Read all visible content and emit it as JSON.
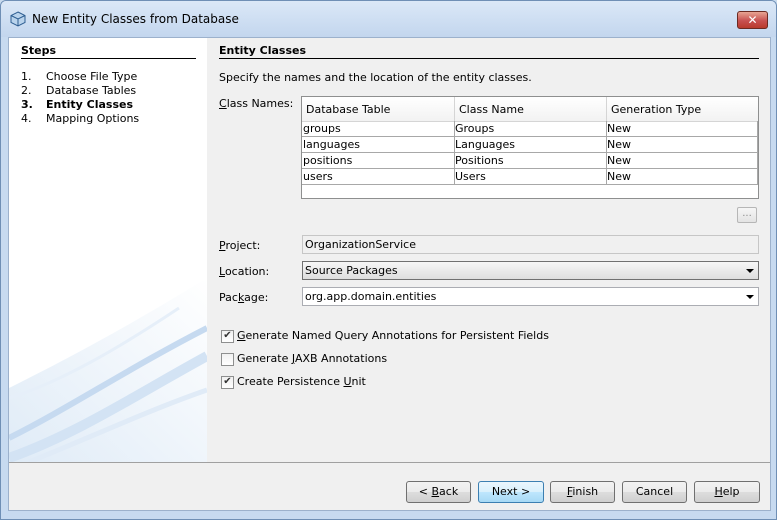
{
  "window": {
    "title": "New Entity Classes from Database",
    "close_label": "✕"
  },
  "steps": {
    "title": "Steps",
    "items": [
      {
        "num": "1.",
        "label": "Choose File Type"
      },
      {
        "num": "2.",
        "label": "Database Tables"
      },
      {
        "num": "3.",
        "label": "Entity Classes"
      },
      {
        "num": "4.",
        "label": "Mapping Options"
      }
    ],
    "current_index": 2
  },
  "panel": {
    "title": "Entity Classes",
    "description": "Specify the names and the location of the entity classes.",
    "class_names_label_pre": "",
    "class_names_label_mn": "C",
    "class_names_label_post": "lass Names:",
    "table": {
      "headers": [
        "Database Table",
        "Class Name",
        "Generation Type"
      ],
      "rows": [
        [
          "groups",
          "Groups",
          "New"
        ],
        [
          "languages",
          "Languages",
          "New"
        ],
        [
          "positions",
          "Positions",
          "New"
        ],
        [
          "users",
          "Users",
          "New"
        ]
      ]
    },
    "ellipsis_label": "...",
    "project_label_pre": "",
    "project_label_mn": "P",
    "project_label_post": "roject:",
    "project_value": "OrganizationService",
    "location_label_pre": "",
    "location_label_mn": "L",
    "location_label_post": "ocation:",
    "location_value": "Source Packages",
    "package_label_pre": "Pac",
    "package_label_mn": "k",
    "package_label_post": "age:",
    "package_value": "org.app.domain.entities",
    "checkboxes": [
      {
        "pre": "",
        "mn": "G",
        "post": "enerate Named Query Annotations for Persistent Fields",
        "checked": true
      },
      {
        "pre": "Generate ",
        "mn": "J",
        "post": "AXB Annotations",
        "checked": false
      },
      {
        "pre": "Create Persistence ",
        "mn": "U",
        "post": "nit",
        "checked": true
      }
    ]
  },
  "buttons": {
    "back_pre": "< ",
    "back_mn": "B",
    "back_post": "ack",
    "next": "Next >",
    "finish_pre": "",
    "finish_mn": "F",
    "finish_post": "inish",
    "cancel": "Cancel",
    "help_pre": "",
    "help_mn": "H",
    "help_post": "elp"
  },
  "colors": {
    "title_bar": "#c3d6ee",
    "close": "#c75050",
    "panel": "#f0f0f0",
    "default_button": "#bee6fd"
  }
}
